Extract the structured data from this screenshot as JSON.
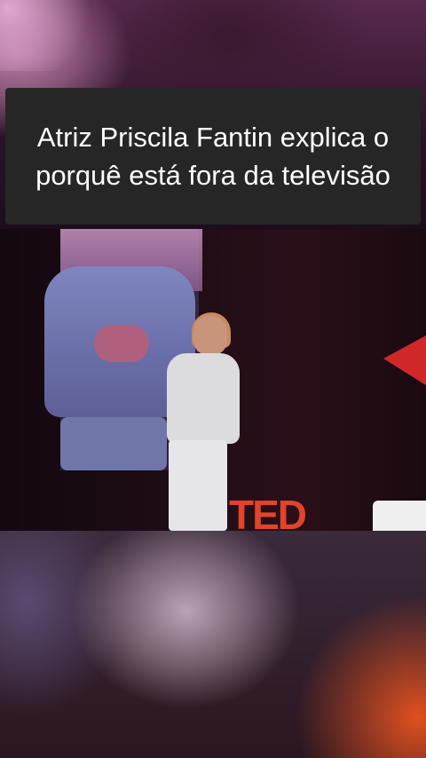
{
  "caption": {
    "text": "Atriz Priscila Fantin explica o porquê está fora da televisão"
  },
  "video": {
    "logo_text": "TED",
    "colors": {
      "ted_red": "#e1442a",
      "caption_bg": "#262626"
    }
  }
}
